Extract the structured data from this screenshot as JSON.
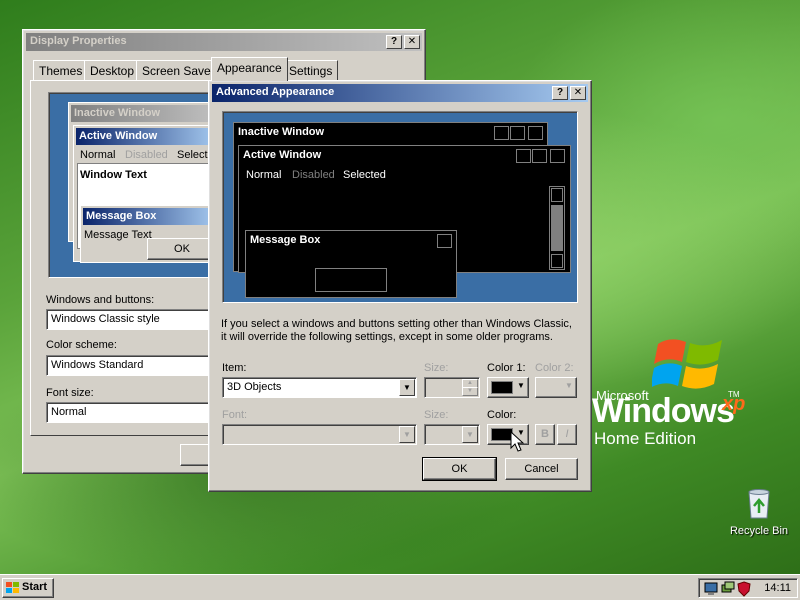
{
  "display_properties": {
    "title": "Display Properties",
    "help": "?",
    "close": "✕",
    "tabs": [
      "Themes",
      "Desktop",
      "Screen Saver",
      "Appearance",
      "Settings"
    ],
    "preview": {
      "inactive_window": "Inactive Window",
      "active_window": "Active Window",
      "menu": [
        "Normal",
        "Disabled",
        "Selected"
      ],
      "window_text": "Window Text",
      "message_box": "Message Box",
      "message_text": "Message Text",
      "ok": "OK"
    },
    "windows_and_buttons_label": "Windows and buttons:",
    "windows_and_buttons_value": "Windows Classic style",
    "color_scheme_label": "Color scheme:",
    "color_scheme_value": "Windows Standard",
    "font_size_label": "Font size:",
    "font_size_value": "Normal"
  },
  "advanced_appearance": {
    "title": "Advanced Appearance",
    "help": "?",
    "close": "✕",
    "preview": {
      "inactive_window": "Inactive Window",
      "active_window": "Active Window",
      "menu": [
        "Normal",
        "Disabled",
        "Selected"
      ],
      "message_box": "Message Box"
    },
    "info_line1": "If you select a windows and buttons setting other than Windows Classic,",
    "info_line2": "it will override the following settings, except in some older programs.",
    "item_label": "Item:",
    "item_value": "3D Objects",
    "size_label": "Size:",
    "color1_label": "Color 1:",
    "color2_label": "Color 2:",
    "font_label": "Font:",
    "font_size_label": "Size:",
    "color_label": "Color:",
    "bold": "B",
    "italic": "I",
    "ok": "OK",
    "cancel": "Cancel"
  },
  "desktop": {
    "logo_microsoft": "Microsoft",
    "logo_windows": "Windows",
    "logo_xp": "xp",
    "logo_tm": "TM",
    "logo_edition": "Home Edition",
    "recycle_bin": "Recycle Bin"
  },
  "taskbar": {
    "start": "Start",
    "clock": "14:11"
  },
  "colors": {
    "active_title": "#0a246a",
    "inactive_title": "#808080",
    "preview_bg": "#3a6ea5"
  }
}
